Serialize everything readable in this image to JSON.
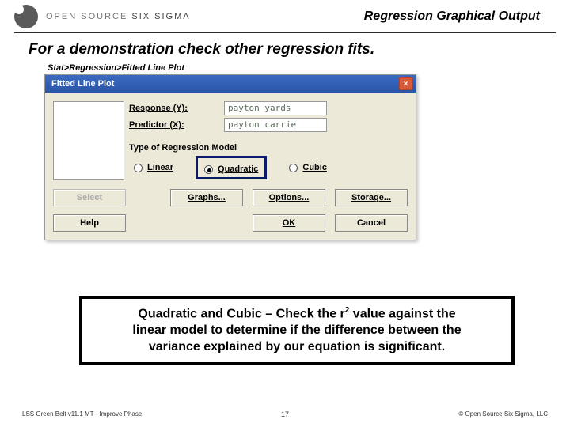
{
  "header": {
    "logo_text_light": "OPEN SOURCE ",
    "logo_text_dark": "SIX SIGMA",
    "slide_title": "Regression Graphical Output"
  },
  "subtitle": "For a demonstration check other regression fits.",
  "menupath": "Stat>Regression>Fitted Line Plot",
  "dialog": {
    "title": "Fitted Line Plot",
    "response_label": "Response (Y):",
    "response_value": "payton yards",
    "predictor_label": "Predictor (X):",
    "predictor_value": "payton carrie",
    "group_label": "Type of Regression Model",
    "radios": {
      "linear": "Linear",
      "quadratic": "Quadratic",
      "cubic": "Cubic"
    },
    "buttons": {
      "select": "Select",
      "graphs": "Graphs...",
      "options": "Options...",
      "storage": "Storage...",
      "help": "Help",
      "ok": "OK",
      "cancel": "Cancel"
    }
  },
  "callout": {
    "line1_a": "Quadratic and Cubic – Check the r",
    "line1_sup": "2",
    "line1_b": " value against the",
    "line2": "linear model to determine if the difference between the",
    "line3": "variance explained by our equation is significant."
  },
  "footer": {
    "left": "LSS Green Belt v11.1 MT - Improve Phase",
    "page": "17",
    "right": "© Open Source Six Sigma, LLC"
  }
}
